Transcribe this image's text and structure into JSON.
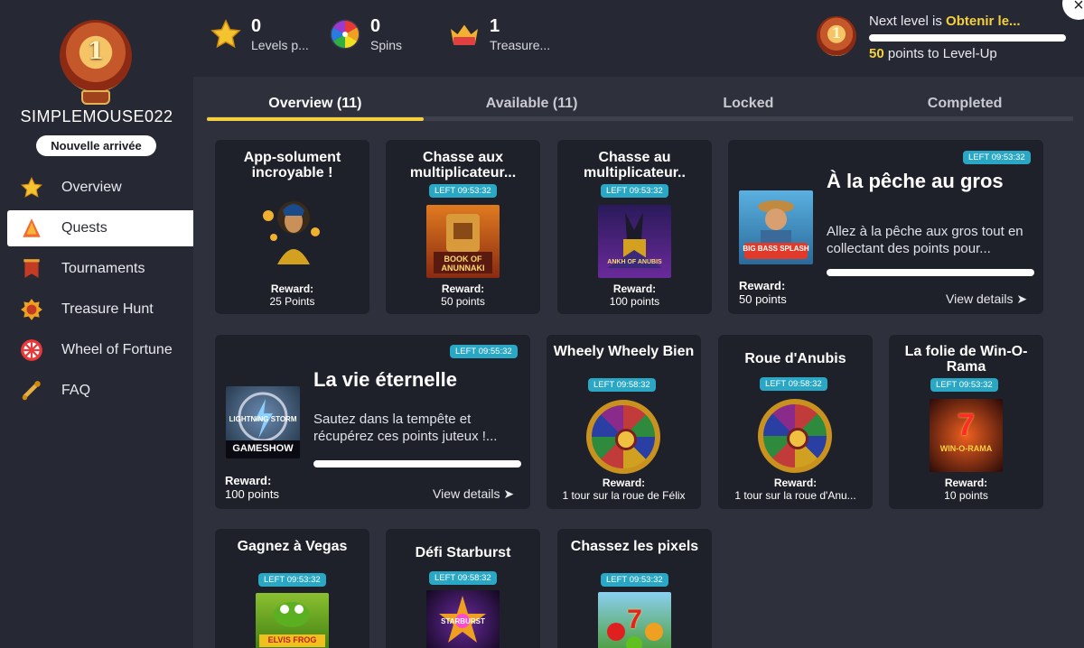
{
  "user": {
    "name": "SIMPLEMOUSE022",
    "status_badge": "Nouvelle arrivée",
    "level_number": "1"
  },
  "sidebar": {
    "items": [
      {
        "label": "Overview",
        "icon": "star-icon"
      },
      {
        "label": "Quests",
        "icon": "quest-cone-icon",
        "active": true
      },
      {
        "label": "Tournaments",
        "icon": "banner-icon"
      },
      {
        "label": "Treasure Hunt",
        "icon": "treasure-gem-icon"
      },
      {
        "label": "Wheel of Fortune",
        "icon": "wheel-icon"
      },
      {
        "label": "FAQ",
        "icon": "scroll-icon"
      }
    ]
  },
  "header": {
    "stats": [
      {
        "value": "0",
        "label": "Levels p...",
        "icon": "star-icon"
      },
      {
        "value": "0",
        "label": "Spins",
        "icon": "color-wheel-icon"
      },
      {
        "value": "1",
        "label": "Treasure...",
        "icon": "crown-icon"
      }
    ],
    "next_level_prefix": "Next level is",
    "next_level_name": "Obtenir le...",
    "points_needed": "50",
    "points_suffix": "points to Level-Up",
    "close_symbol": "×"
  },
  "tabs": [
    "Overview (11)",
    "Available (11)",
    "Locked",
    "Completed"
  ],
  "reward_label": "Reward:",
  "view_details": "View details",
  "view_details_arrow": "➤",
  "cards": {
    "c1": {
      "title": "App-solument incroyable !",
      "reward": "25 Points"
    },
    "c2": {
      "title": "Chasse aux multiplicateur...",
      "timer": "LEFT 09:53:32",
      "reward": "50 points",
      "thumb_text": "BOOK OF ANUNNAKI"
    },
    "c3": {
      "title": "Chasse au multiplicateur..",
      "timer": "LEFT 09:53:32",
      "reward": "100 points",
      "thumb_text": "ANKH OF ANUBIS"
    },
    "c4": {
      "title": "À la pêche au gros",
      "timer": "LEFT 09:53:32",
      "desc": "Allez à la pêche aux gros tout en collectant des points pour...",
      "reward": "50 points",
      "thumb_text": "BIG BASS SPLASH"
    },
    "c5": {
      "title": "La vie éternelle",
      "timer": "LEFT 09:55:32",
      "desc": "Sautez dans la tempête et récupérez ces points juteux !...",
      "reward": "100 points",
      "thumb_text": "LIGHTNING STORM",
      "thumb_sub": "GAMESHOW"
    },
    "c6": {
      "title": "Wheely Wheely Bien",
      "timer": "LEFT 09:58:32",
      "reward": "1 tour sur la roue de Félix"
    },
    "c7": {
      "title": "Roue d'Anubis",
      "timer": "LEFT 09:58:32",
      "reward": "1 tour sur la roue d'Anu..."
    },
    "c8": {
      "title": "La folie de Win-O-Rama",
      "timer": "LEFT 09:53:32",
      "reward": "10 points",
      "thumb_text": "WIN-O-RAMA"
    },
    "c9": {
      "title": "Gagnez à Vegas",
      "timer": "LEFT 09:53:32",
      "thumb_text": "ELVIS FROG"
    },
    "c10": {
      "title": "Défi Starburst",
      "timer": "LEFT 09:58:32",
      "thumb_text": "STARBURST"
    },
    "c11": {
      "title": "Chassez les pixels",
      "timer": "LEFT 09:53:32",
      "thumb_text": "7"
    }
  }
}
